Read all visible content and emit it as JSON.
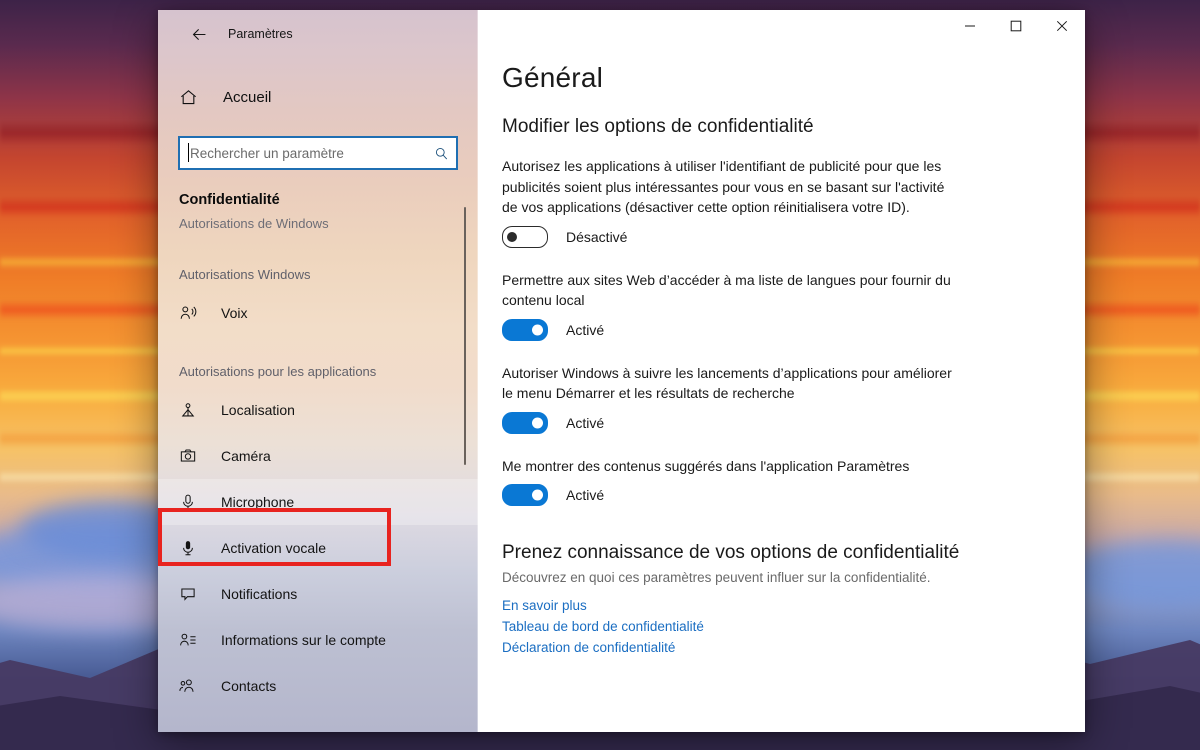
{
  "window": {
    "title": "Paramètres",
    "back_icon": "back-arrow-icon",
    "controls": {
      "minimize": "—",
      "maximize": "▢",
      "close": "✕"
    }
  },
  "sidebar": {
    "home": {
      "label": "Accueil",
      "icon": "home-icon"
    },
    "search": {
      "value": "",
      "placeholder": "Rechercher un paramètre",
      "icon": "search-icon"
    },
    "section_title": "Confidentialité",
    "clipped_group_title": "Autorisations de Windows",
    "groups": [
      {
        "title": "Autorisations Windows",
        "items": [
          {
            "label": "Voix",
            "icon": "voice-person-icon",
            "selected": false
          }
        ]
      },
      {
        "title": "Autorisations pour les applications",
        "items": [
          {
            "label": "Localisation",
            "icon": "location-pin-icon",
            "selected": false
          },
          {
            "label": "Caméra",
            "icon": "camera-icon",
            "selected": false
          },
          {
            "label": "Microphone",
            "icon": "microphone-icon",
            "selected": true
          },
          {
            "label": "Activation vocale",
            "icon": "voice-activation-icon",
            "selected": false
          },
          {
            "label": "Notifications",
            "icon": "notification-bubble-icon",
            "selected": false
          },
          {
            "label": "Informations sur le compte",
            "icon": "account-info-icon",
            "selected": false
          },
          {
            "label": "Contacts",
            "icon": "contacts-icon",
            "selected": false
          }
        ]
      }
    ]
  },
  "main": {
    "page_title": "Général",
    "sub_head": "Modifier les options de confidentialité",
    "settings": [
      {
        "description": "Autorisez les applications à utiliser l'identifiant de publicité pour que les publicités soient plus intéressantes pour vous en se basant sur l'activité de vos applications (désactiver cette option réinitialisera votre ID).",
        "state": "off",
        "state_label": "Désactivé"
      },
      {
        "description": "Permettre aux sites Web d’accéder à ma liste de langues pour fournir du contenu local",
        "state": "on",
        "state_label": "Activé"
      },
      {
        "description": "Autoriser Windows à suivre les lancements d’applications pour améliorer le menu Démarrer et les résultats de recherche",
        "state": "on",
        "state_label": "Activé"
      },
      {
        "description": "Me montrer des contenus suggérés dans l'application Paramètres",
        "state": "on",
        "state_label": "Activé"
      }
    ],
    "learn_more": {
      "heading": "Prenez connaissance de vos options de confidentialité",
      "subtext": "Découvrez en quoi ces paramètres peuvent influer sur la confidentialité.",
      "links": [
        "En savoir plus",
        "Tableau de bord de confidentialité",
        "Déclaration de confidentialité"
      ]
    }
  },
  "annotation": {
    "highlight_color": "#e8231f",
    "highlight_target": "Microphone"
  },
  "colors": {
    "accent": "#0a78d4",
    "link": "#1b6ec2",
    "search_border": "#1f6fb2"
  }
}
